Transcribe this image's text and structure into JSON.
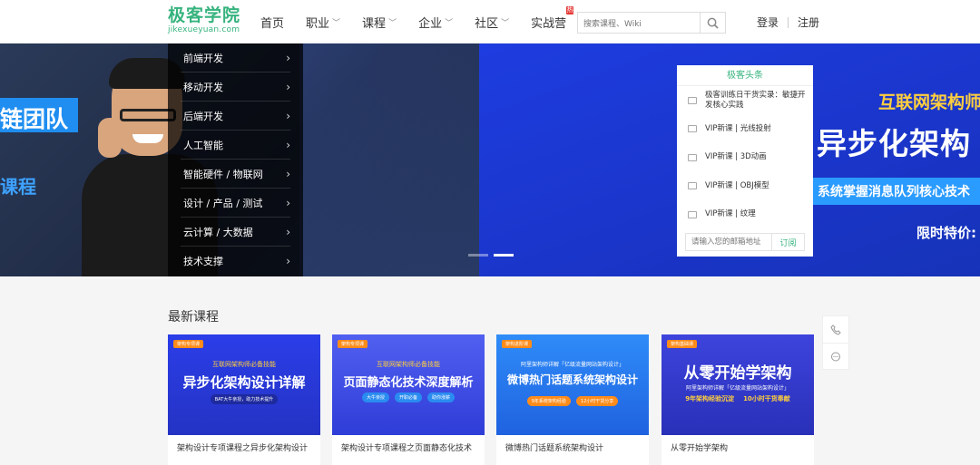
{
  "header": {
    "logo_text": "极客学院",
    "logo_sub": "jikexueyuan.com",
    "nav": [
      {
        "label": "首页",
        "has_chevron": false
      },
      {
        "label": "职业",
        "has_chevron": true
      },
      {
        "label": "课程",
        "has_chevron": true
      },
      {
        "label": "企业",
        "has_chevron": true
      },
      {
        "label": "社区",
        "has_chevron": true
      },
      {
        "label": "实战营",
        "has_chevron": false,
        "badge": "热"
      }
    ],
    "search_placeholder": "搜索课程、Wiki",
    "login": "登录",
    "register": "注册"
  },
  "banner": {
    "left_band_text": "链团队",
    "left_text2": "课程",
    "right_title1": "互联网架构师",
    "right_title2": "异步化架构",
    "right_band_text": "系统掌握消息队列核心技术",
    "right_price": "限时特价:",
    "active_slide": 2,
    "slide_count": 2
  },
  "categories": [
    "前端开发",
    "移动开发",
    "后端开发",
    "人工智能",
    "智能硬件 / 物联网",
    "设计 / 产品 / 测试",
    "云计算 / 大数据",
    "技术支撑"
  ],
  "news": {
    "title": "极客头条",
    "items": [
      "极客训练日干货实录：敏捷开发核心实践",
      "VIP新课 | 光线投射",
      "VIP新课 | 3D动画",
      "VIP新课 | OBJ模型",
      "VIP新课 | 纹理"
    ],
    "email_placeholder": "请输入您的邮箱地址",
    "subscribe": "订阅"
  },
  "courses_section": {
    "title": "最新课程",
    "courses": [
      {
        "tag": "架构专项课",
        "sub": "互联网架构师必备技能",
        "main": "异步化架构设计详解",
        "pills": [
          "BAT大牛亲授，助力技术提升"
        ],
        "name": "架构设计专项课程之异步化架构设计"
      },
      {
        "tag": "架构专项课",
        "sub": "互联网架构师必备技能",
        "main": "页面静态化技术深度解析",
        "pills": [
          "大牛亲授",
          "开职必备",
          "助你涨薪"
        ],
        "name": "架构设计专项课程之页面静态化技术"
      },
      {
        "tag": "架构进阶课",
        "sub": "阿里架构师详解「亿级流量网站架构设计」",
        "main": "微博热门话题系统架构设计",
        "pills": [
          "9年系统架构经验",
          "12小时干货分享"
        ],
        "name": "微博热门话题系统架构设计"
      },
      {
        "tag": "架构基础课",
        "sub": "阿里架构师详解「亿级流量网站架构设计」",
        "main": "从零开始学架构",
        "pills": [
          "9年架构经验沉淀",
          "10小时干货奉献"
        ],
        "name": "从零开始学架构"
      }
    ]
  },
  "colors": {
    "brand_green": "#36b37e",
    "banner_blue": "#1e3de0",
    "highlight_yellow": "#ffcf3d",
    "tag_orange": "#ff8c1a"
  },
  "icons": {
    "search": "magnifier-icon",
    "phone": "phone-icon",
    "chat": "chat-icon",
    "news_item": "video-icon"
  }
}
